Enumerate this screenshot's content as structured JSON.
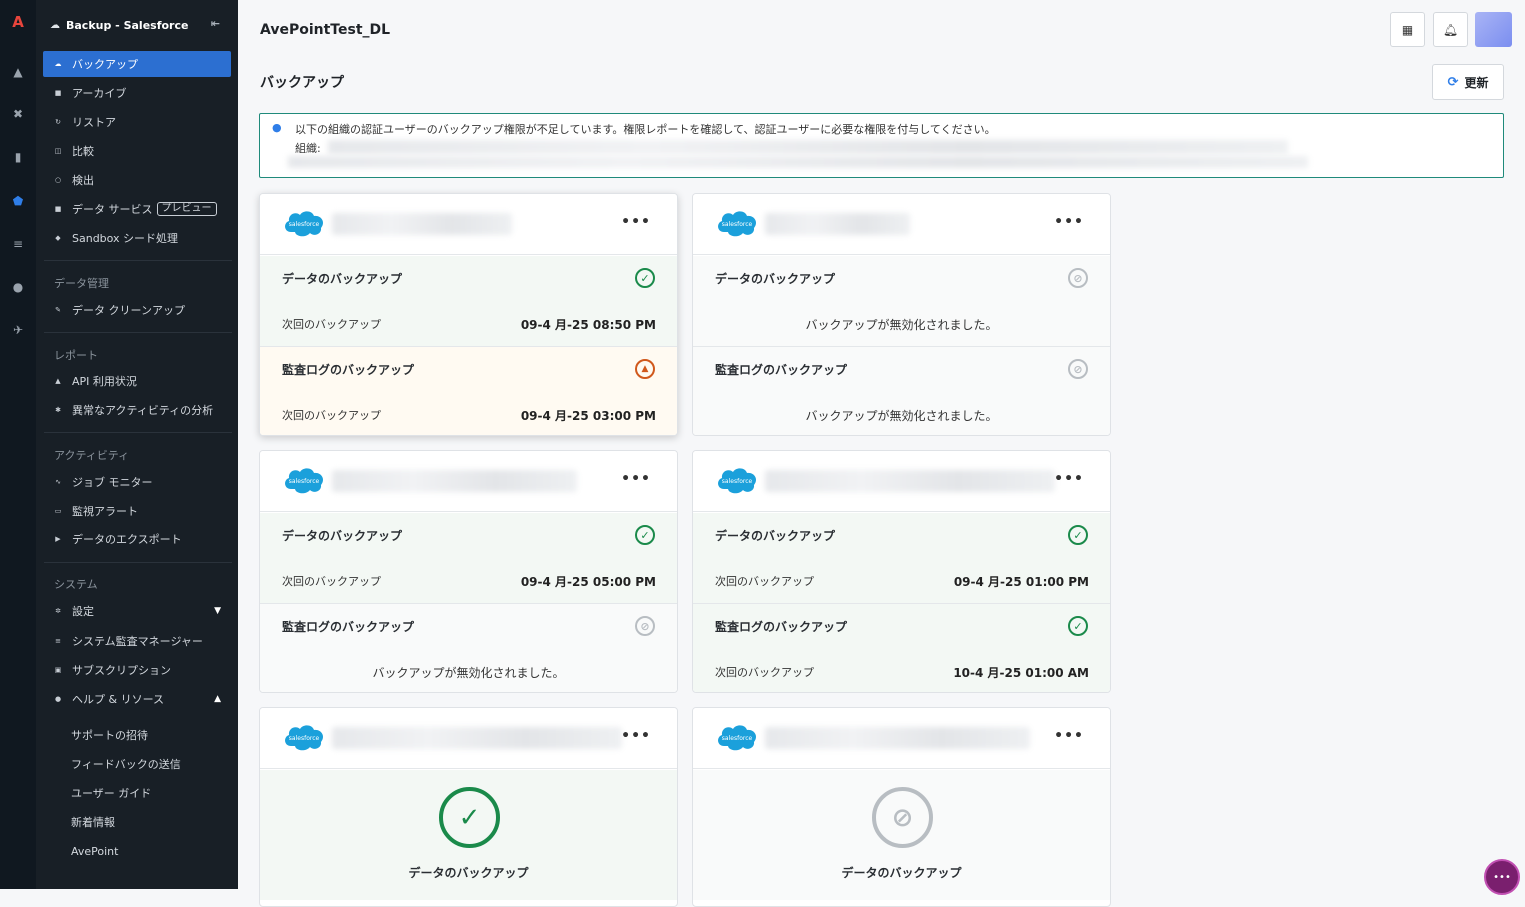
{
  "app": {
    "name": "Backup - Salesforce",
    "tenant": "AvePointTest_DL",
    "page_title": "バックアップ",
    "refresh_label": "更新"
  },
  "sidebar": {
    "items": [
      {
        "label": "バックアップ",
        "icon": "cloud-icon",
        "active": true
      },
      {
        "label": "アーカイブ",
        "icon": "archive-icon"
      },
      {
        "label": "リストア",
        "icon": "restore-icon"
      },
      {
        "label": "比較",
        "icon": "compare-icon"
      },
      {
        "label": "検出",
        "icon": "search-icon"
      },
      {
        "label": "データ サービス",
        "icon": "data-service-icon",
        "badge": "プレビュー"
      },
      {
        "label": "Sandbox シード処理",
        "icon": "sandbox-icon"
      }
    ],
    "sections": [
      {
        "title": "データ管理",
        "items": [
          {
            "label": "データ クリーンアップ",
            "icon": "broom-icon"
          }
        ]
      },
      {
        "title": "レポート",
        "items": [
          {
            "label": "API 利用状況",
            "icon": "chart-icon"
          },
          {
            "label": "異常なアクティビティの分析",
            "icon": "anomaly-icon"
          }
        ]
      },
      {
        "title": "アクティビティ",
        "items": [
          {
            "label": "ジョブ モニター",
            "icon": "activity-icon"
          },
          {
            "label": "監視アラート",
            "icon": "monitor-icon"
          },
          {
            "label": "データのエクスポート",
            "icon": "export-icon"
          }
        ]
      },
      {
        "title": "システム",
        "items": [
          {
            "label": "設定",
            "icon": "gear-icon"
          },
          {
            "label": "システム監査マネージャー",
            "icon": "list-icon"
          },
          {
            "label": "サブスクリプション",
            "icon": "subscription-icon"
          },
          {
            "label": "ヘルプ & リソース",
            "icon": "help-icon"
          }
        ]
      }
    ],
    "help_sub": [
      "サポートの招待",
      "フィードバックの送信",
      "ユーザー ガイド",
      "新着情報",
      "AvePoint"
    ]
  },
  "alert": {
    "message": "以下の組織の認証ユーザーのバックアップ権限が不足しています。権限レポートを確認して、認証ユーザーに必要な権限を付与してください。",
    "org_label": "組織:"
  },
  "labels": {
    "data_backup": "データのバックアップ",
    "audit_backup": "監査ログのバックアップ",
    "next_backup": "次回のバックアップ",
    "disabled": "バックアップが無効化されました。",
    "logo_text": "salesforce",
    "more": "•••"
  },
  "cards": [
    {
      "data_status": "success",
      "data_next": "09-4 月-25 08:50 PM",
      "audit_status": "warning",
      "audit_next": "09-4 月-25 03:00 PM"
    },
    {
      "data_status": "disabled",
      "audit_status": "disabled"
    },
    {
      "data_status": "success",
      "data_next": "09-4 月-25 05:00 PM",
      "audit_status": "disabled"
    },
    {
      "data_status": "success",
      "data_next": "09-4 月-25 01:00 PM",
      "audit_status": "success",
      "audit_next": "10-4 月-25 01:00 AM"
    },
    {
      "data_status": "success"
    },
    {
      "data_status": "disabled"
    }
  ],
  "colors": {
    "accent": "#2c6fd1",
    "success": "#1a8a4a",
    "warning": "#d0581c",
    "disabled": "#b8bdc2",
    "sidebar_bg": "#181f26",
    "rail_bg": "#101820"
  }
}
